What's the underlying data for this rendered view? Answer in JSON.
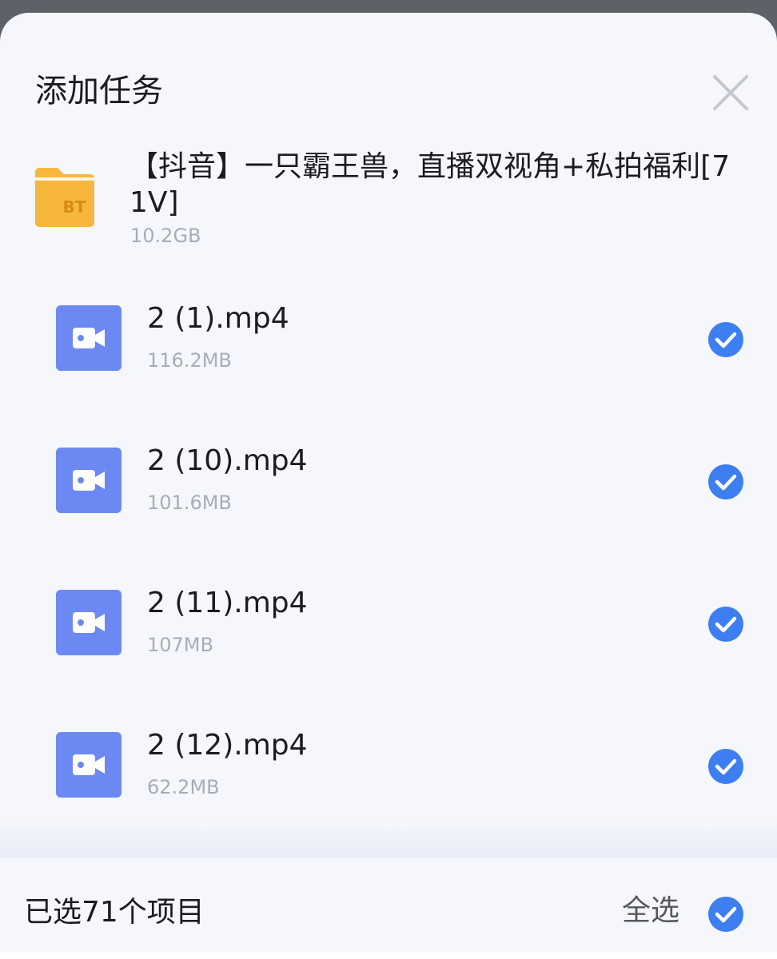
{
  "dialog": {
    "title": "添加任务",
    "close_icon": "close-icon"
  },
  "torrent": {
    "icon": "bt-folder-icon",
    "icon_label": "BT",
    "name": "【抖音】一只霸王兽，直播双视角+私拍福利[71V]",
    "size": "10.2GB"
  },
  "files": [
    {
      "name": "2 (1).mp4",
      "size": "116.2MB",
      "icon": "video-camera-icon",
      "checked": true
    },
    {
      "name": "2 (10).mp4",
      "size": "101.6MB",
      "icon": "video-camera-icon",
      "checked": true
    },
    {
      "name": "2 (11).mp4",
      "size": "107MB",
      "icon": "video-camera-icon",
      "checked": true
    },
    {
      "name": "2 (12).mp4",
      "size": "62.2MB",
      "icon": "video-camera-icon",
      "checked": true
    }
  ],
  "footer": {
    "selected_count": "已选71个项目",
    "select_all_label": "全选",
    "select_all_checked": true
  },
  "colors": {
    "accent": "#3d7ef0",
    "video_icon_bg": "#6c89f3",
    "folder": "#f6b73c",
    "folder_label": "#d98c12",
    "secondary_text": "#a7adb6",
    "sheet_bg": "#f5f7fc"
  }
}
